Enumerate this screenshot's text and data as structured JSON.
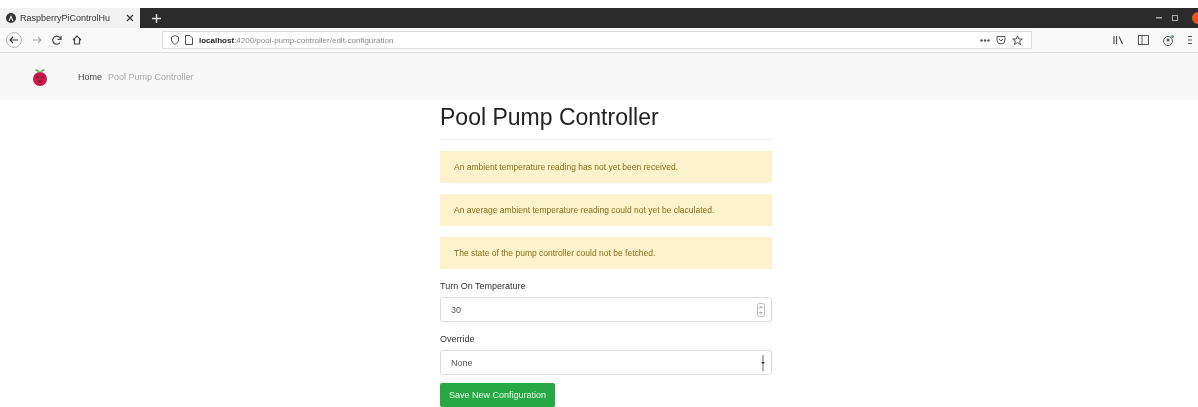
{
  "browser": {
    "tab": {
      "title": "RaspberryPiControlHu",
      "selected": true
    },
    "url": "**localhost**:4200/pool-pump-controller/edit-configuration"
  },
  "navbar": {
    "items": [
      {
        "label": "Home",
        "selected": true
      },
      {
        "label": "Pool Pump Controller",
        "selected": false
      }
    ]
  },
  "page": {
    "title": "Pool Pump Controller",
    "alerts": [
      "An ambient temperature reading has not yet been received.",
      "An average ambient temperature reading could not yet be claculated.",
      "The state of the pump controller could not be fetched."
    ],
    "fields": [
      {
        "kind": "number",
        "label": "Turn On Temperature",
        "value": "30"
      },
      {
        "kind": "select",
        "label": "Override",
        "value": "None"
      }
    ],
    "button": "Save New Configuration"
  }
}
